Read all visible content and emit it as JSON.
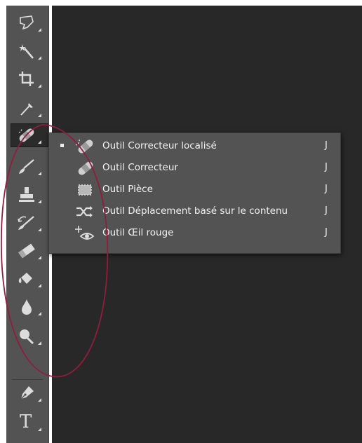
{
  "toolbar": {
    "tools": [
      {
        "name": "lasso-icon"
      },
      {
        "name": "magic-wand-icon"
      },
      {
        "name": "crop-icon"
      },
      {
        "name": "eyedropper-icon"
      },
      {
        "name": "spot-healing-brush-icon",
        "active": true
      },
      {
        "name": "brush-icon"
      },
      {
        "name": "clone-stamp-icon"
      },
      {
        "name": "history-brush-icon"
      },
      {
        "name": "eraser-icon"
      },
      {
        "name": "paint-bucket-icon"
      },
      {
        "name": "blur-icon"
      },
      {
        "name": "dodge-icon"
      },
      {
        "name": "pen-icon"
      },
      {
        "name": "type-icon"
      }
    ],
    "type_tool_glyph": "T"
  },
  "flyout": {
    "items": [
      {
        "label": "Outil Correcteur localisé",
        "shortcut": "J",
        "selected": true,
        "icon": "spot-healing-brush-icon"
      },
      {
        "label": "Outil Correcteur",
        "shortcut": "J",
        "selected": false,
        "icon": "healing-brush-icon"
      },
      {
        "label": "Outil Pièce",
        "shortcut": "J",
        "selected": false,
        "icon": "patch-icon"
      },
      {
        "label": "Outil Déplacement basé sur le contenu",
        "shortcut": "J",
        "selected": false,
        "icon": "content-aware-move-icon"
      },
      {
        "label": "Outil Œil rouge",
        "shortcut": "J",
        "selected": false,
        "icon": "red-eye-icon"
      }
    ]
  },
  "colors": {
    "toolbar_bg": "#535353",
    "canvas_bg": "#282828",
    "annotation_ring": "#8e1e3c"
  }
}
